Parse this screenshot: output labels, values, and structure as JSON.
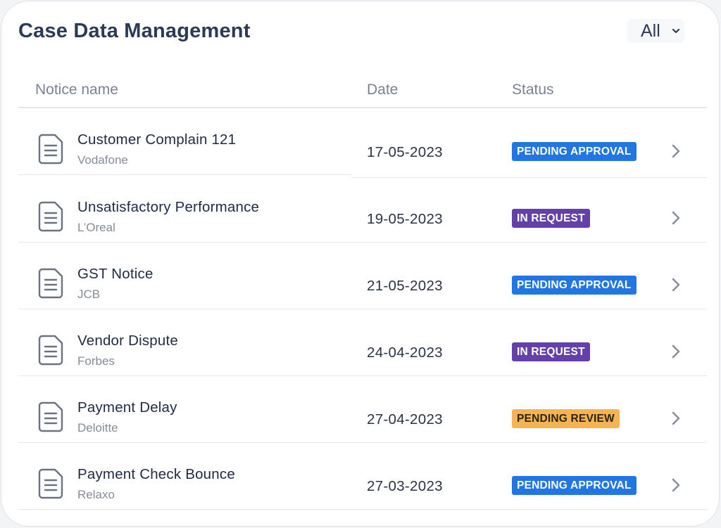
{
  "header": {
    "title": "Case Data Management",
    "filter_value": "All"
  },
  "table": {
    "columns": [
      "Notice name",
      "Date",
      "Status"
    ],
    "rows": [
      {
        "name": "Customer Complain 121",
        "company": "Vodafone",
        "date": "17-05-2023",
        "status": "PENDING APPROVAL",
        "status_kind": "pa"
      },
      {
        "name": "Unsatisfactory Performance",
        "company": "L’Oreal",
        "date": "19-05-2023",
        "status": "IN REQUEST",
        "status_kind": "ir"
      },
      {
        "name": "GST Notice",
        "company": "JCB",
        "date": "21-05-2023",
        "status": "PENDING APPROVAL",
        "status_kind": "pa"
      },
      {
        "name": "Vendor Dispute",
        "company": "Forbes",
        "date": "24-04-2023",
        "status": "IN REQUEST",
        "status_kind": "ir"
      },
      {
        "name": "Payment Delay",
        "company": "Deloitte",
        "date": "27-04-2023",
        "status": "PENDING REVIEW",
        "status_kind": "pr"
      },
      {
        "name": "Payment Check Bounce",
        "company": "Relaxo",
        "date": "27-03-2023",
        "status": "PENDING APPROVAL",
        "status_kind": "pa"
      }
    ]
  },
  "icons": {
    "row_icon": "document-icon",
    "row_action": "chevron-right-icon",
    "filter_icon": "chevron-down-icon"
  },
  "colors": {
    "title": "#2b3a55",
    "pending_approval": "#2176e4",
    "in_request": "#6441a8",
    "pending_review": "#f5b451"
  }
}
